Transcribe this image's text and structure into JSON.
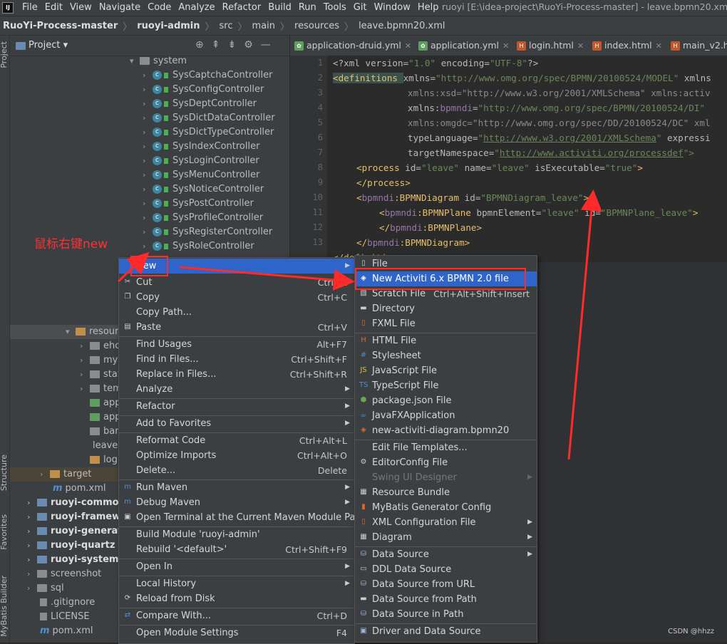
{
  "menubar": {
    "logo": "IJ",
    "items": [
      "File",
      "Edit",
      "View",
      "Navigate",
      "Code",
      "Analyze",
      "Refactor",
      "Build",
      "Run",
      "Tools",
      "Git",
      "Window",
      "Help"
    ],
    "window_title": "ruoyi [E:\\idea-project\\RuoYi-Process-master] - leave.bpmn20.xml [ru"
  },
  "breadcrumb": [
    "RuoYi-Process-master",
    "ruoyi-admin",
    "src",
    "main",
    "resources",
    "leave.bpmn20.xml"
  ],
  "stripe": {
    "top": "Project",
    "structure": "Structure",
    "favorites": "Favorites",
    "mybatis": "MyBatis Builder"
  },
  "project": {
    "title": "Project",
    "tree": [
      {
        "label": "system",
        "kind": "pkg"
      },
      {
        "label": "SysCaptchaController",
        "kind": "class"
      },
      {
        "label": "SysConfigController",
        "kind": "class"
      },
      {
        "label": "SysDeptController",
        "kind": "class"
      },
      {
        "label": "SysDictDataController",
        "kind": "class"
      },
      {
        "label": "SysDictTypeController",
        "kind": "class"
      },
      {
        "label": "SysIndexController",
        "kind": "class"
      },
      {
        "label": "SysLoginController",
        "kind": "class"
      },
      {
        "label": "SysMenuController",
        "kind": "class"
      },
      {
        "label": "SysNoticeController",
        "kind": "class"
      },
      {
        "label": "SysPostController",
        "kind": "class"
      },
      {
        "label": "SysProfileController",
        "kind": "class"
      },
      {
        "label": "SysRegisterController",
        "kind": "class"
      },
      {
        "label": "SysRoleController",
        "kind": "class"
      }
    ],
    "partial": [
      "resour",
      "ehc",
      "myb",
      "stat",
      "tem",
      "app",
      "app",
      "ban",
      "leave.l",
      "log"
    ],
    "lower": [
      {
        "label": "target",
        "kind": "folder"
      },
      {
        "label": "pom.xml",
        "kind": "maven"
      },
      {
        "label": "ruoyi-common",
        "kind": "module"
      },
      {
        "label": "ruoyi-framewo",
        "kind": "module"
      },
      {
        "label": "ruoyi-generato",
        "kind": "module"
      },
      {
        "label": "ruoyi-quartz",
        "kind": "module"
      },
      {
        "label": "ruoyi-system",
        "kind": "module"
      },
      {
        "label": "screenshot",
        "kind": "folder"
      },
      {
        "label": "sql",
        "kind": "folder"
      },
      {
        "label": ".gitignore",
        "kind": "file"
      },
      {
        "label": "LICENSE",
        "kind": "file"
      },
      {
        "label": "pom.xml",
        "kind": "maven"
      }
    ]
  },
  "tabs": [
    "application-druid.yml",
    "application.yml",
    "login.html",
    "index.html",
    "main_v2.ht"
  ],
  "code": {
    "line_numbers": [
      "1",
      "2",
      "3",
      "4",
      "5",
      "6",
      "7",
      "8",
      "9",
      "10",
      "11",
      "12",
      "13"
    ],
    "l1": [
      "<?xml ",
      "version=",
      "\"1.0\"",
      "encoding=",
      "\"UTF-8\"",
      "?>"
    ],
    "l2": [
      "<definitions ",
      "xmlns=",
      "\"http://www.omg.org/spec/BPMN/20100524/MODEL\"",
      "xmlns"
    ],
    "l3": [
      "xmlns:xsd=\"http://www.w3.org/2001/XMLSchema\" xmlns:activ"
    ],
    "l4": [
      "xmlns:",
      "bpmndi",
      "=",
      "\"http://www.omg.org/spec/BPMN/20100524/DI\""
    ],
    "l5": [
      "xmlns:omgdc=\"http://www.omg.org/spec/DD/20100524/DC\" xml"
    ],
    "l6": [
      "typeLanguage=",
      "\"",
      "http://www.w3.org/2001/XMLSchema",
      "\"",
      "expressi"
    ],
    "l7": [
      "targetNamespace=",
      "\"",
      "http://www.activiti.org/processdef",
      "\">"
    ],
    "l8": [
      "<process ",
      "id=",
      "\"leave\" ",
      "name=",
      "\"leave\" ",
      "isExecutable=",
      "\"true\"",
      ">"
    ],
    "l9": [
      "</process>"
    ],
    "l10": [
      "<",
      "bpmndi",
      ":BPMNDiagram ",
      "id=",
      "\"BPMNDiagram_leave\"",
      ">"
    ],
    "l11": [
      "<",
      "bpmndi",
      ":BPMNPlane ",
      "bpmnElement=",
      "\"leave\" ",
      "id=",
      "\"BPMNPlane_leave\"",
      ">"
    ],
    "l12": [
      "</",
      "bpmndi",
      ":BPMNPlane>"
    ],
    "l13": [
      "</",
      "bpmndi",
      ":BPMNDiagram>"
    ],
    "l14": [
      "</definitions>"
    ]
  },
  "annotation": {
    "note": "鼠标右键new",
    "watermark": "CSDN @hhzz",
    "color": "#ff2a2a"
  },
  "context_menu": [
    {
      "label": "New",
      "shortcut": "",
      "submenu": true,
      "selected": true
    },
    {
      "label": "Cut",
      "shortcut": "Ctrl+X",
      "icon": "scissors-icon"
    },
    {
      "label": "Copy",
      "shortcut": "Ctrl+C",
      "icon": "copy-icon"
    },
    {
      "label": "Copy Path...",
      "shortcut": ""
    },
    {
      "label": "Paste",
      "shortcut": "Ctrl+V",
      "icon": "paste-icon"
    },
    {
      "label": "Find Usages",
      "shortcut": "Alt+F7"
    },
    {
      "label": "Find in Files...",
      "shortcut": "Ctrl+Shift+F"
    },
    {
      "label": "Replace in Files...",
      "shortcut": "Ctrl+Shift+R"
    },
    {
      "label": "Analyze",
      "shortcut": "",
      "submenu": true
    },
    {
      "label": "Refactor",
      "shortcut": "",
      "submenu": true
    },
    {
      "label": "Add to Favorites",
      "shortcut": "",
      "submenu": true
    },
    {
      "label": "Reformat Code",
      "shortcut": "Ctrl+Alt+L"
    },
    {
      "label": "Optimize Imports",
      "shortcut": "Ctrl+Alt+O"
    },
    {
      "label": "Delete...",
      "shortcut": "Delete"
    },
    {
      "label": "Run Maven",
      "shortcut": "",
      "submenu": true,
      "icon": "maven-icon"
    },
    {
      "label": "Debug Maven",
      "shortcut": "",
      "submenu": true,
      "icon": "maven-icon"
    },
    {
      "label": "Open Terminal at the Current Maven Module Path",
      "shortcut": "",
      "icon": "terminal-icon"
    },
    {
      "label": "Build Module 'ruoyi-admin'",
      "shortcut": ""
    },
    {
      "label": "Rebuild '<default>'",
      "shortcut": "Ctrl+Shift+F9"
    },
    {
      "label": "Open In",
      "shortcut": "",
      "submenu": true
    },
    {
      "label": "Local History",
      "shortcut": "",
      "submenu": true
    },
    {
      "label": "Reload from Disk",
      "shortcut": "",
      "icon": "reload-icon"
    },
    {
      "label": "Compare With...",
      "shortcut": "Ctrl+D",
      "icon": "compare-icon"
    },
    {
      "label": "Open Module Settings",
      "shortcut": "F4"
    }
  ],
  "new_submenu": [
    {
      "label": "File",
      "icon": "file-icon"
    },
    {
      "label": "New Activiti 6.x BPMN 2.0 file",
      "icon": "bpmn-icon",
      "selected": true
    },
    {
      "label": "Scratch File",
      "shortcut": "Ctrl+Alt+Shift+Insert",
      "icon": "scratch-icon"
    },
    {
      "label": "Directory",
      "icon": "folder-icon"
    },
    {
      "label": "FXML File",
      "icon": "fxml-icon"
    },
    {
      "label": "HTML File",
      "icon": "html-icon"
    },
    {
      "label": "Stylesheet",
      "icon": "css-icon"
    },
    {
      "label": "JavaScript File",
      "icon": "js-icon"
    },
    {
      "label": "TypeScript File",
      "icon": "ts-icon"
    },
    {
      "label": "package.json File",
      "icon": "npm-icon"
    },
    {
      "label": "JavaFXApplication",
      "icon": "javafx-icon"
    },
    {
      "label": "new-activiti-diagram.bpmn20",
      "icon": "bpmn-icon"
    },
    {
      "label": "Edit File Templates...",
      "icon": ""
    },
    {
      "label": "EditorConfig File",
      "icon": "gear-icon"
    },
    {
      "label": "Swing UI Designer",
      "icon": "",
      "disabled": true,
      "submenu": true
    },
    {
      "label": "Resource Bundle",
      "icon": "bundle-icon"
    },
    {
      "label": "MyBatis Generator Config",
      "icon": "mybatis-icon"
    },
    {
      "label": "XML Configuration File",
      "icon": "xml-icon",
      "submenu": true
    },
    {
      "label": "Diagram",
      "icon": "diagram-icon",
      "submenu": true
    },
    {
      "label": "Data Source",
      "icon": "db-icon",
      "submenu": true
    },
    {
      "label": "DDL Data Source",
      "icon": "ddl-icon"
    },
    {
      "label": "Data Source from URL",
      "icon": "db-icon"
    },
    {
      "label": "Data Source from Path",
      "icon": "folder-icon"
    },
    {
      "label": "Data Source in Path",
      "icon": "db-icon"
    },
    {
      "label": "Driver and Data Source",
      "icon": "driver-icon"
    }
  ]
}
